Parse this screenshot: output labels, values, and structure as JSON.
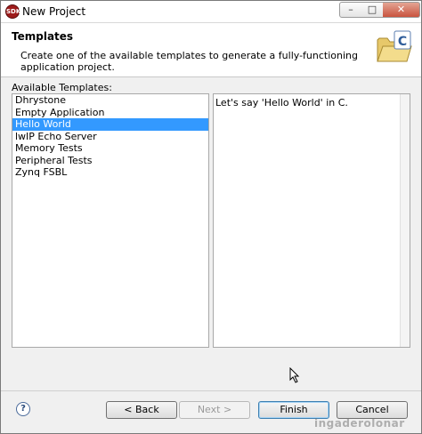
{
  "window": {
    "title": "New Project",
    "app_icon_text": "SDK"
  },
  "header": {
    "title": "Templates",
    "description": "Create one of the available templates to generate a fully-functioning application project."
  },
  "templates": {
    "label": "Available Templates:",
    "items": [
      "Dhrystone",
      "Empty Application",
      "Hello World",
      "lwIP Echo Server",
      "Memory Tests",
      "Peripheral Tests",
      "Zynq FSBL"
    ],
    "selected": "Hello World",
    "description": "Let's say 'Hello World' in C."
  },
  "buttons": {
    "help": "?",
    "back": "< Back",
    "next": "Next >",
    "finish": "Finish",
    "cancel": "Cancel"
  },
  "watermark": "ingaderolonar",
  "colors": {
    "selection": "#3399ff",
    "close_button": "#c9533f"
  }
}
